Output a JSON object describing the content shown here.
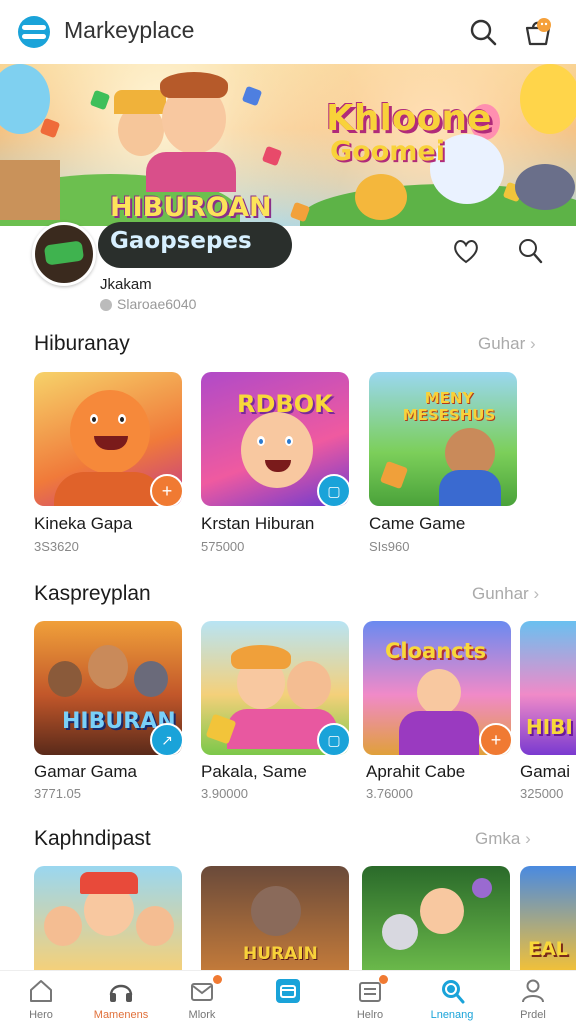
{
  "header": {
    "app_title": "Markeyplace",
    "icons": [
      "logo-icon",
      "search-icon",
      "shop-bag-icon"
    ]
  },
  "banner": {
    "left_title": "HIBUROAN",
    "right_title_1": "Khloone",
    "right_title_2": "Goomei"
  },
  "brand": {
    "pill_text": "Gaopsepes",
    "name": "Jkakam",
    "meta": "Slaroae6040",
    "icons": [
      "heart-icon",
      "search-icon"
    ]
  },
  "sections": [
    {
      "title": "Hiburanay",
      "see_all": "Guhar",
      "cards": [
        {
          "title": "Kineka Gapa",
          "meta": "3S3620",
          "badge": "+",
          "badge_color": "#f07a32"
        },
        {
          "title": "Krstan Hiburan",
          "meta": "575000",
          "badge": "cart",
          "badge_color": "#1aa3d9",
          "art_text": "RDBOK"
        },
        {
          "title": "Came Game",
          "meta": "SIs960",
          "art_text": "MENY MESESHUS"
        }
      ]
    },
    {
      "title": "Kaspreyplan",
      "see_all": "Gunhar",
      "cards": [
        {
          "title": "Gamar Gama",
          "meta": "3771.05",
          "badge": "share",
          "badge_color": "#1aa3d9",
          "art_text": "HIBURAN"
        },
        {
          "title": "Pakala, Same",
          "meta": "3.90000",
          "badge": "cart",
          "badge_color": "#1aa3d9"
        },
        {
          "title": "Aprahit Cabe",
          "meta": "3.76000",
          "badge": "+",
          "badge_color": "#f07a32",
          "art_text": "Cloancts"
        },
        {
          "title": "Gamai",
          "meta": "325000",
          "art_text": "HIBI"
        }
      ]
    },
    {
      "title": "Kaphndipast",
      "see_all": "Gmka",
      "cards": [
        {
          "title": "",
          "meta": ""
        },
        {
          "title": "",
          "meta": "",
          "art_text": "HURAIN"
        },
        {
          "title": "",
          "meta": ""
        },
        {
          "title": "",
          "meta": "",
          "art_text": "EAL"
        }
      ]
    }
  ],
  "tabbar": {
    "items": [
      {
        "label": "Hero",
        "icon": "home-icon",
        "color": "#777"
      },
      {
        "label": "Mamenens",
        "icon": "headphones-icon",
        "color": "#e0703a"
      },
      {
        "label": "Mlork",
        "icon": "mail-icon",
        "color": "#777"
      },
      {
        "label": "",
        "icon": "store-icon",
        "color": "#1aa3d9"
      },
      {
        "label": "Helro",
        "icon": "inbox-icon",
        "color": "#777"
      },
      {
        "label": "Lnenang",
        "icon": "search-icon",
        "color": "#1aa3d9"
      },
      {
        "label": "Prdel",
        "icon": "profile-icon",
        "color": "#777"
      }
    ]
  }
}
